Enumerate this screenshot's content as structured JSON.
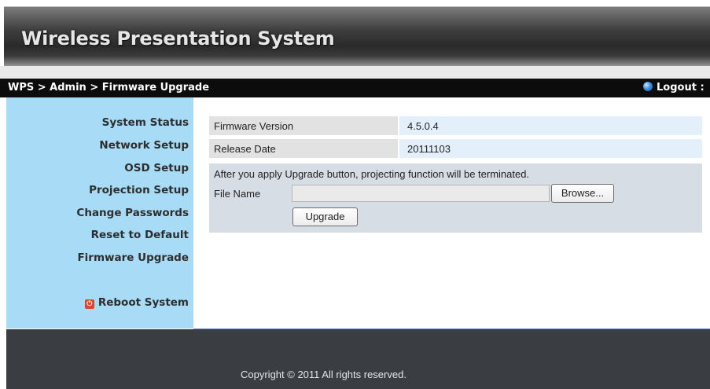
{
  "header": {
    "title": "Wireless Presentation System"
  },
  "breadcrumb": {
    "text": "WPS > Admin > Firmware Upgrade"
  },
  "logout": {
    "label": "Logout :"
  },
  "sidebar": {
    "items": [
      {
        "label": "System Status"
      },
      {
        "label": "Network Setup"
      },
      {
        "label": "OSD Setup"
      },
      {
        "label": "Projection Setup"
      },
      {
        "label": "Change Passwords"
      },
      {
        "label": "Reset to Default"
      },
      {
        "label": "Firmware Upgrade"
      }
    ],
    "reboot": {
      "label": "Reboot System",
      "icon": "power-icon"
    }
  },
  "firmware": {
    "version_label": "Firmware Version",
    "version_value": "4.5.0.4",
    "date_label": "Release Date",
    "date_value": "20111103"
  },
  "upgrade": {
    "notice": "After you apply Upgrade button, projecting function will be terminated.",
    "file_label": "File Name",
    "file_value": "",
    "browse_label": "Browse...",
    "upgrade_label": "Upgrade"
  },
  "footer": {
    "copyright": "Copyright © 2011 All rights reserved."
  }
}
